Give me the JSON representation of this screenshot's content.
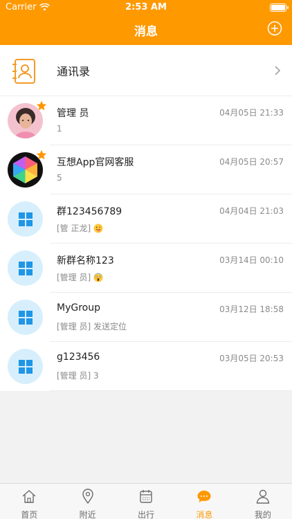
{
  "status_bar": {
    "carrier": "Carrier",
    "time": "2:53 AM"
  },
  "header": {
    "title": "消息"
  },
  "contacts": {
    "label": "通讯录"
  },
  "conversations": [
    {
      "name": "管理 员",
      "preview": "1",
      "datetime": "04月05日 21:33",
      "avatar": "photo-girl",
      "starred": true
    },
    {
      "name": "互想App官网客服",
      "preview": "5",
      "datetime": "04月05日 20:57",
      "avatar": "colorful-polyhedron",
      "starred": true
    },
    {
      "name": "群123456789",
      "preview": "[管 正龙]",
      "emoji": "tongue-out-emoji",
      "datetime": "04月04日 21:03",
      "avatar": "group",
      "starred": false
    },
    {
      "name": "新群名称123",
      "preview": "[管理 员]",
      "emoji": "scream-emoji",
      "datetime": "03月14日 00:10",
      "avatar": "group",
      "starred": false
    },
    {
      "name": "MyGroup",
      "preview": "[管理 员] 发送定位",
      "datetime": "03月12日 18:58",
      "avatar": "group",
      "starred": false
    },
    {
      "name": "g123456",
      "preview": "[管理 员] 3",
      "datetime": "03月05日 20:53",
      "avatar": "group",
      "starred": false
    }
  ],
  "tabbar": {
    "items": [
      {
        "label": "首页",
        "icon": "home-icon",
        "active": false
      },
      {
        "label": "附近",
        "icon": "location-pin-icon",
        "active": false
      },
      {
        "label": "出行",
        "icon": "calendar-icon",
        "active": false
      },
      {
        "label": "消息",
        "icon": "chat-bubble-icon",
        "active": true
      },
      {
        "label": "我的",
        "icon": "person-icon",
        "active": false
      }
    ]
  },
  "colors": {
    "brand": "#ff9900",
    "group_avatar_bg": "#d7effc",
    "group_icon": "#1f96e6"
  }
}
